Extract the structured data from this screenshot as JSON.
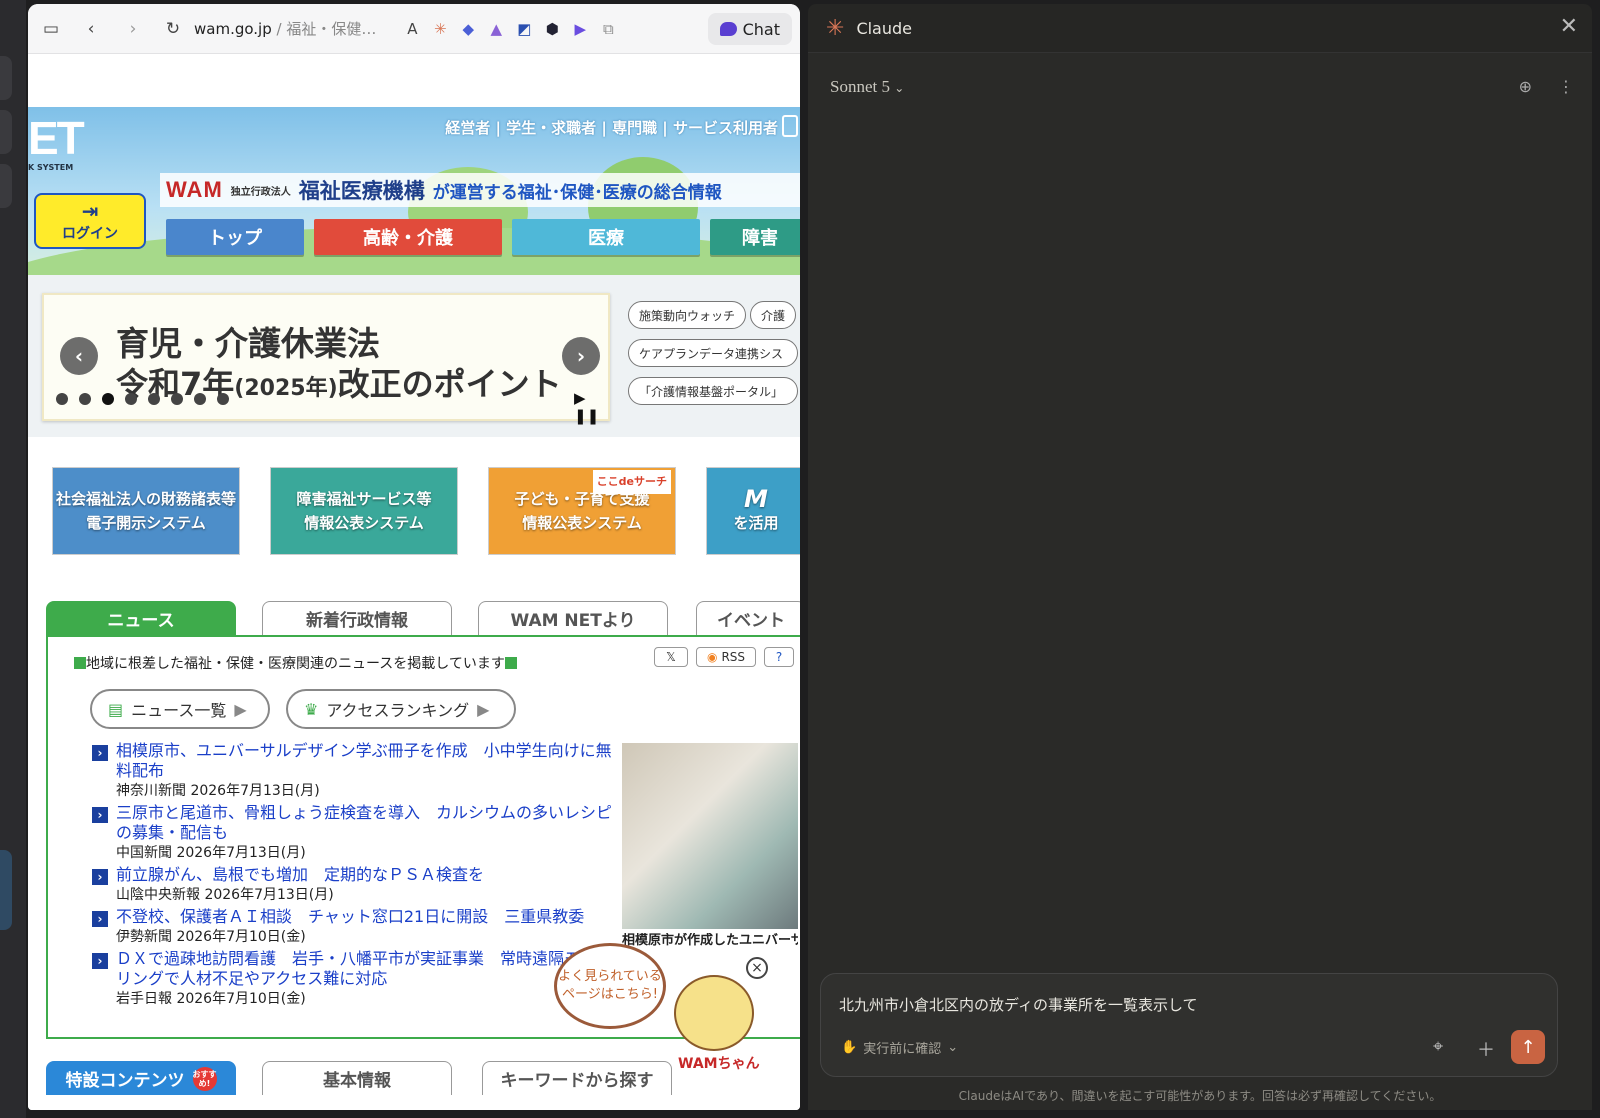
{
  "browser": {
    "url_domain": "wam.go.jp",
    "url_rest": " / 福祉・保健…",
    "chat_button": "Chat"
  },
  "header": {
    "logo_text": "ET",
    "logo_sub": "K SYSTEM",
    "audience_links": "経営者 | 学生・求職者 | 専門職 | サービス利用者",
    "wam_logo": "WAM",
    "wam_small": "独立行政法人",
    "wam_org": "福祉医療機構",
    "wam_rest": "が運営する福祉･保健･医療の総合情報",
    "login": "ログイン",
    "nav": [
      "トップ",
      "高齢・介護",
      "医療",
      "障害"
    ]
  },
  "slider": {
    "title1": "育児・介護休業法",
    "title2a": "令和7年",
    "title2b": "(2025年)",
    "title2c": "改正のポイント",
    "prev": "‹",
    "next": "›",
    "controls": "▶ ❚❚"
  },
  "tags": [
    "施策動向ウォッチ",
    "介護",
    "ケアプランデータ連携シス",
    "「介護情報基盤ポータル」"
  ],
  "systems": [
    {
      "line1": "社会福祉法人の財務諸表等",
      "line2": "電子開示システム",
      "color": "#4d8ec9"
    },
    {
      "line1": "障害福祉サービス等",
      "line2": "情報公表システム",
      "color": "#3aa89a"
    },
    {
      "line1": "子ども・子育て支援",
      "line2": "情報公表システム",
      "color": "#f0a035",
      "badge": "ここdeサーチ"
    },
    {
      "line1": "M",
      "line2": "を活用",
      "color": "#3d9fc7"
    }
  ],
  "tabs": [
    "ニュース",
    "新着行政情報",
    "WAM NETより",
    "イベント"
  ],
  "news": {
    "intro": "地域に根差した福祉・保健・医療関連のニュースを掲載しています",
    "share_x": "𝕏",
    "share_rss": "RSS",
    "share_help": "?",
    "btn_list": "ニュース一覧",
    "btn_ranking": "アクセスランキング",
    "items": [
      {
        "title": "相模原市、ユニバーサルデザイン学ぶ冊子を作成　小中学生向けに無料配布",
        "source": "神奈川新聞 2026年7月13日(月)"
      },
      {
        "title": "三原市と尾道市、骨粗しょう症検査を導入　カルシウムの多いレシピの募集・配信も",
        "source": "中国新聞 2026年7月13日(月)"
      },
      {
        "title": "前立腺がん、島根でも増加　定期的なＰＳＡ検査を",
        "source": "山陰中央新報 2026年7月13日(月)"
      },
      {
        "title": "不登校、保護者ＡＩ相談　チャット窓口21日に開設　三重県教委",
        "source": "伊勢新聞 2026年7月10日(金)"
      },
      {
        "title": "ＤＸで過疎地訪問看護　岩手・八幡平市が実証事業　常時遠隔モニタリングで人材不足やアクセス難に対応",
        "source": "岩手日報 2026年7月10日(金)"
      }
    ],
    "photo_caption": "相模原市が作成したユニバーサルデザインを学ぶ小中学生向け",
    "popular": "よく見られている\nページはこちら!",
    "wamchan": "WAMちゃん",
    "close": "×"
  },
  "bottom_tabs": [
    "特設コンテンツ",
    "基本情報",
    "キーワードから探す"
  ],
  "osusume": "おすすめ!",
  "claude": {
    "title": "Claude",
    "model": "Sonnet 5",
    "prompt": "北九州市小倉北区内の放ディの事業所を一覧表示して",
    "mode": "実行前に確認",
    "disclaimer": "ClaudeはAIであり、間違いを起こす可能性があります。回答は必ず再確認してください。",
    "accent": "#d97757"
  }
}
